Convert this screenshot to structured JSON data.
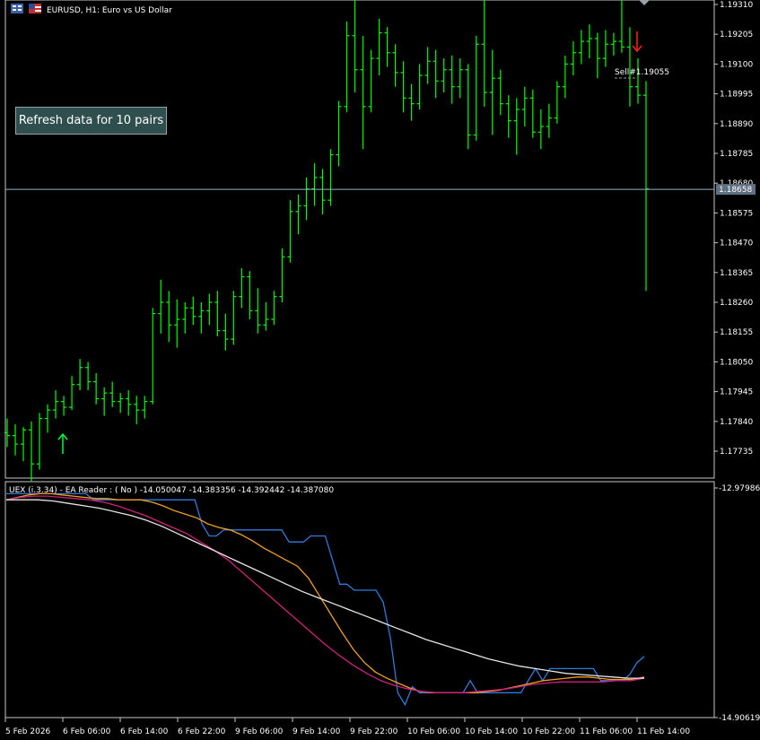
{
  "header": {
    "symbol_title": "EURUSD, H1:  Euro vs US Dollar"
  },
  "button": {
    "refresh_label": "Refresh data for 10 pairs"
  },
  "trade": {
    "label": "Sell#1.19055"
  },
  "indicator": {
    "title": "UEX (i.3.34) - EA Reader : ( No ) -14.050047 -14.383356 -14.392442 -14.387080"
  },
  "colors": {
    "candle": "#00ff00",
    "grid_line": "#8fb3c8",
    "price_tag_bg": "#607080",
    "buy_arrow": "#00ff40",
    "sell_arrow": "#ff2020",
    "series_blue": "#2f7bdc",
    "series_orange": "#f0a020",
    "series_magenta": "#d0207a",
    "series_white": "#e6e6e6",
    "border": "#c8c8c8"
  },
  "chart_data": [
    {
      "type": "candlestick",
      "title": "EURUSD, H1:  Euro vs US Dollar",
      "ylim": [
        1.1767,
        1.1937
      ],
      "y_ticks": [
        "1.19310",
        "1.19205",
        "1.19100",
        "1.18995",
        "1.18890",
        "1.18785",
        "1.18680",
        "1.18575",
        "1.18470",
        "1.18365",
        "1.18260",
        "1.18155",
        "1.18050",
        "1.17945",
        "1.17840",
        "1.17735"
      ],
      "current_price": "1.18658",
      "x_ticks": [
        "5 Feb 2026",
        "6 Feb 06:00",
        "6 Feb 14:00",
        "6 Feb 22:00",
        "9 Feb 06:00",
        "9 Feb 14:00",
        "9 Feb 22:00",
        "10 Feb 06:00",
        "10 Feb 14:00",
        "10 Feb 22:00",
        "11 Feb 06:00",
        "11 Feb 14:00"
      ],
      "bars": [
        [
          1.178,
          1.1785,
          1.1775,
          1.1779
        ],
        [
          1.1779,
          1.1783,
          1.1772,
          1.1776
        ],
        [
          1.1776,
          1.1782,
          1.177,
          1.1781
        ],
        [
          1.1781,
          1.1784,
          1.1763,
          1.1769
        ],
        [
          1.1769,
          1.1787,
          1.1767,
          1.1785
        ],
        [
          1.1785,
          1.179,
          1.178,
          1.1788
        ],
        [
          1.1788,
          1.1795,
          1.1785,
          1.1791
        ],
        [
          1.1791,
          1.1793,
          1.1786,
          1.1789
        ],
        [
          1.1789,
          1.18,
          1.1788,
          1.1797
        ],
        [
          1.1797,
          1.1806,
          1.1795,
          1.1803
        ],
        [
          1.1803,
          1.1805,
          1.1795,
          1.1798
        ],
        [
          1.1798,
          1.1801,
          1.179,
          1.1792
        ],
        [
          1.1792,
          1.1796,
          1.1786,
          1.1794
        ],
        [
          1.1794,
          1.1798,
          1.1789,
          1.1791
        ],
        [
          1.1791,
          1.1794,
          1.1787,
          1.1792
        ],
        [
          1.1792,
          1.1795,
          1.1786,
          1.179
        ],
        [
          1.179,
          1.1793,
          1.1783,
          1.1788
        ],
        [
          1.1788,
          1.1793,
          1.1785,
          1.1791
        ],
        [
          1.1791,
          1.1824,
          1.179,
          1.1822
        ],
        [
          1.1822,
          1.1834,
          1.1815,
          1.1826
        ],
        [
          1.1826,
          1.183,
          1.1812,
          1.1818
        ],
        [
          1.1818,
          1.1827,
          1.181,
          1.182
        ],
        [
          1.182,
          1.1826,
          1.1815,
          1.1824
        ],
        [
          1.1824,
          1.1828,
          1.1818,
          1.1821
        ],
        [
          1.1821,
          1.1826,
          1.1815,
          1.1823
        ],
        [
          1.1823,
          1.1829,
          1.1818,
          1.1826
        ],
        [
          1.1826,
          1.183,
          1.1814,
          1.1816
        ],
        [
          1.1816,
          1.1822,
          1.1809,
          1.1813
        ],
        [
          1.1813,
          1.183,
          1.1811,
          1.1828
        ],
        [
          1.1828,
          1.1838,
          1.1824,
          1.1835
        ],
        [
          1.1835,
          1.1837,
          1.182,
          1.1823
        ],
        [
          1.1823,
          1.1831,
          1.1815,
          1.1818
        ],
        [
          1.1818,
          1.1826,
          1.1816,
          1.182
        ],
        [
          1.182,
          1.183,
          1.1818,
          1.1828
        ],
        [
          1.1828,
          1.1845,
          1.1826,
          1.1842
        ],
        [
          1.1842,
          1.1862,
          1.184,
          1.1858
        ],
        [
          1.1858,
          1.1864,
          1.185,
          1.186
        ],
        [
          1.186,
          1.187,
          1.1855,
          1.1866
        ],
        [
          1.1866,
          1.1875,
          1.186,
          1.187
        ],
        [
          1.187,
          1.1873,
          1.1857,
          1.1862
        ],
        [
          1.1862,
          1.188,
          1.186,
          1.1878
        ],
        [
          1.1878,
          1.1897,
          1.1874,
          1.1895
        ],
        [
          1.1895,
          1.1925,
          1.1893,
          1.192
        ],
        [
          1.192,
          1.1935,
          1.19,
          1.1908
        ],
        [
          1.1908,
          1.192,
          1.188,
          1.1895
        ],
        [
          1.1895,
          1.1915,
          1.1893,
          1.1912
        ],
        [
          1.1912,
          1.1926,
          1.1906,
          1.1921
        ],
        [
          1.1921,
          1.1923,
          1.1909,
          1.1914
        ],
        [
          1.1914,
          1.1917,
          1.1902,
          1.1907
        ],
        [
          1.1907,
          1.1911,
          1.1893,
          1.1898
        ],
        [
          1.1898,
          1.1903,
          1.189,
          1.1896
        ],
        [
          1.1896,
          1.191,
          1.1894,
          1.1906
        ],
        [
          1.1906,
          1.1916,
          1.1903,
          1.1911
        ],
        [
          1.1911,
          1.1915,
          1.1898,
          1.1904
        ],
        [
          1.1904,
          1.1912,
          1.19,
          1.1908
        ],
        [
          1.1908,
          1.1913,
          1.1896,
          1.1902
        ],
        [
          1.1902,
          1.1912,
          1.1898,
          1.1908
        ],
        [
          1.1908,
          1.191,
          1.188,
          1.1885
        ],
        [
          1.1885,
          1.192,
          1.1883,
          1.1917
        ],
        [
          1.1917,
          1.1935,
          1.1895,
          1.19
        ],
        [
          1.19,
          1.1915,
          1.1885,
          1.1905
        ],
        [
          1.1905,
          1.1908,
          1.1892,
          1.1896
        ],
        [
          1.1896,
          1.1899,
          1.1884,
          1.189
        ],
        [
          1.189,
          1.1898,
          1.1878,
          1.1894
        ],
        [
          1.1894,
          1.1902,
          1.1888,
          1.1898
        ],
        [
          1.1898,
          1.1901,
          1.1884,
          1.1886
        ],
        [
          1.1886,
          1.1894,
          1.188,
          1.1888
        ],
        [
          1.1888,
          1.1896,
          1.1884,
          1.1891
        ],
        [
          1.1891,
          1.1904,
          1.1889,
          1.1902
        ],
        [
          1.1902,
          1.1913,
          1.1898,
          1.191
        ],
        [
          1.191,
          1.1918,
          1.1906,
          1.1914
        ],
        [
          1.1914,
          1.1922,
          1.191,
          1.1918
        ],
        [
          1.1918,
          1.1924,
          1.1912,
          1.1919
        ],
        [
          1.1919,
          1.1921,
          1.1905,
          1.1912
        ],
        [
          1.1912,
          1.1922,
          1.1909,
          1.1917
        ],
        [
          1.1917,
          1.1921,
          1.1913,
          1.1918
        ],
        [
          1.1918,
          1.1934,
          1.1914,
          1.1916
        ],
        [
          1.1916,
          1.1923,
          1.1895,
          1.1902
        ],
        [
          1.1902,
          1.1912,
          1.1896,
          1.1899
        ],
        [
          1.1899,
          1.1904,
          1.183,
          1.1866
        ]
      ]
    },
    {
      "type": "line",
      "title": "UEX (i.3.34) - EA Reader : ( No ) -14.050047 -14.383356 -14.392442 -14.387080",
      "ylim": [
        -14.906193,
        -12.97986
      ],
      "y_ticks": [
        "-12.97986",
        "-14.906193"
      ],
      "series": [
        {
          "color": "#2f7bdc",
          "values": [
            -13.05,
            -13.05,
            -13.05,
            -13.05,
            -13.05,
            -13.05,
            -13.05,
            -13.05,
            -13.05,
            -13.05,
            -13.05,
            -13.05,
            -13.1,
            -13.1,
            -13.1,
            -13.1,
            -13.1,
            -13.1,
            -13.1,
            -13.1,
            -13.1,
            -13.1,
            -13.1,
            -13.1,
            -13.1,
            -13.1,
            -13.1,
            -13.3,
            -13.4,
            -13.4,
            -13.35,
            -13.35,
            -13.35,
            -13.35,
            -13.35,
            -13.35,
            -13.35,
            -13.35,
            -13.35,
            -13.45,
            -13.45,
            -13.45,
            -13.4,
            -13.4,
            -13.4,
            -13.6,
            -13.8,
            -13.8,
            -13.85,
            -13.85,
            -13.85,
            -13.85,
            -13.95,
            -14.25,
            -14.7,
            -14.8,
            -14.65,
            -14.7,
            -14.7,
            -14.7,
            -14.7,
            -14.7,
            -14.7,
            -14.7,
            -14.6,
            -14.7,
            -14.7,
            -14.7,
            -14.7,
            -14.7,
            -14.7,
            -14.7,
            -14.6,
            -14.5,
            -14.6,
            -14.5,
            -14.5,
            -14.5,
            -14.5,
            -14.5,
            -14.5,
            -14.5,
            -14.6,
            -14.6,
            -14.6,
            -14.6,
            -14.55,
            -14.45,
            -14.4
          ]
        },
        {
          "color": "#f0a020",
          "values": [
            -13.1,
            -13.08,
            -13.06,
            -13.05,
            -13.05,
            -13.06,
            -13.07,
            -13.08,
            -13.09,
            -13.09,
            -13.1,
            -13.1,
            -13.1,
            -13.12,
            -13.15,
            -13.19,
            -13.22,
            -13.25,
            -13.3,
            -13.33,
            -13.35,
            -13.39,
            -13.44,
            -13.5,
            -13.55,
            -13.6,
            -13.65,
            -13.75,
            -13.9,
            -14.05,
            -14.2,
            -14.34,
            -14.45,
            -14.53,
            -14.58,
            -14.62,
            -14.66,
            -14.69,
            -14.7,
            -14.7,
            -14.7,
            -14.7,
            -14.7,
            -14.69,
            -14.68,
            -14.66,
            -14.64,
            -14.62,
            -14.6,
            -14.59,
            -14.58,
            -14.57,
            -14.57,
            -14.58,
            -14.59,
            -14.59,
            -14.59,
            -14.57
          ]
        },
        {
          "color": "#d0207a",
          "values": [
            -13.1,
            -13.08,
            -13.07,
            -13.07,
            -13.08,
            -13.09,
            -13.1,
            -13.12,
            -13.15,
            -13.19,
            -13.23,
            -13.28,
            -13.33,
            -13.38,
            -13.45,
            -13.52,
            -13.6,
            -13.7,
            -13.8,
            -13.9,
            -14.0,
            -14.1,
            -14.2,
            -14.3,
            -14.39,
            -14.47,
            -14.54,
            -14.6,
            -14.64,
            -14.67,
            -14.69,
            -14.7,
            -14.7,
            -14.7,
            -14.69,
            -14.68,
            -14.67,
            -14.65,
            -14.63,
            -14.62,
            -14.61,
            -14.61,
            -14.61,
            -14.61,
            -14.6,
            -14.6,
            -14.58
          ]
        },
        {
          "color": "#e6e6e6",
          "values": [
            -13.1,
            -13.1,
            -13.1,
            -13.11,
            -13.13,
            -13.15,
            -13.17,
            -13.2,
            -13.23,
            -13.27,
            -13.32,
            -13.38,
            -13.44,
            -13.5,
            -13.56,
            -13.62,
            -13.68,
            -13.74,
            -13.8,
            -13.86,
            -13.91,
            -13.96,
            -14.01,
            -14.06,
            -14.11,
            -14.16,
            -14.21,
            -14.26,
            -14.3,
            -14.34,
            -14.38,
            -14.42,
            -14.45,
            -14.48,
            -14.5,
            -14.52,
            -14.54,
            -14.55,
            -14.56,
            -14.57,
            -14.58,
            -14.58
          ]
        }
      ]
    }
  ]
}
